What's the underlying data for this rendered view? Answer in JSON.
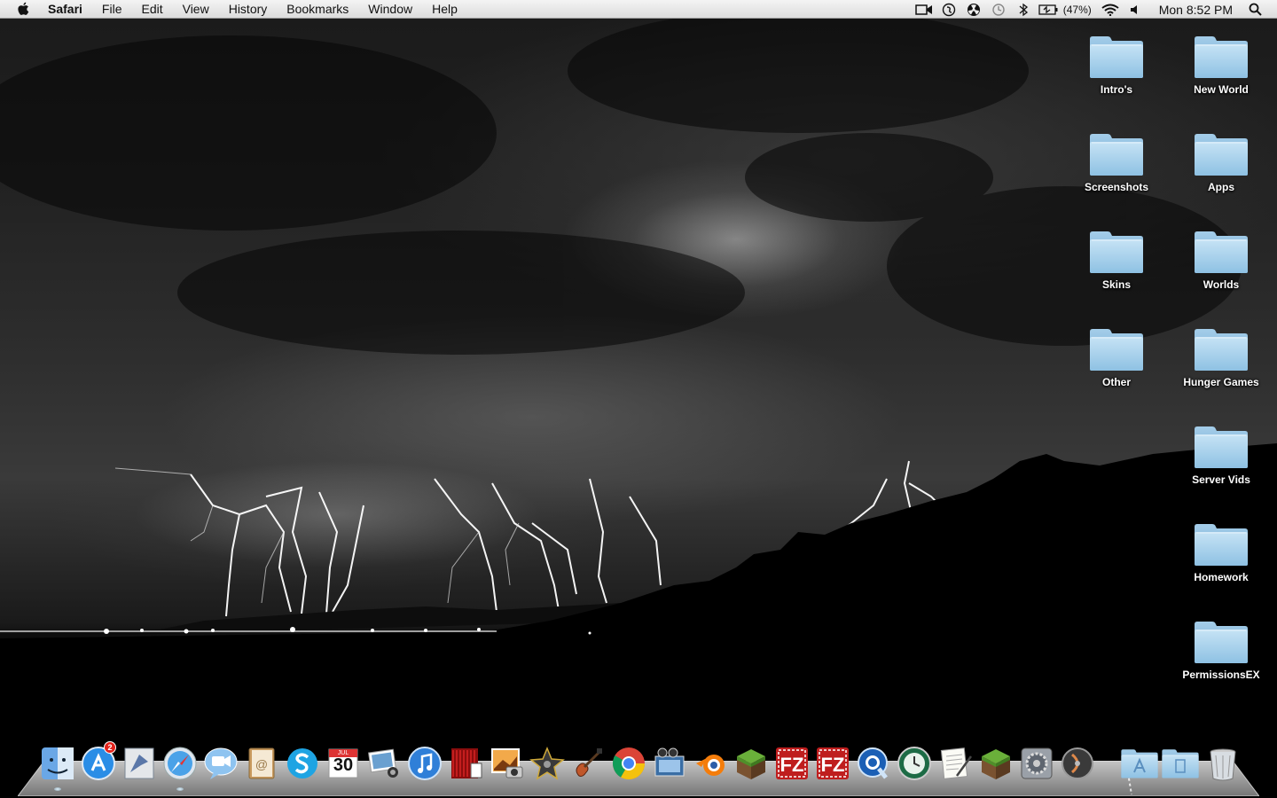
{
  "menubar": {
    "app_name": "Safari",
    "menus": [
      "File",
      "Edit",
      "View",
      "History",
      "Bookmarks",
      "Window",
      "Help"
    ],
    "status": {
      "battery_percent": "(47%)",
      "clock": "Mon 8:52 PM"
    },
    "icons": [
      "camera-icon",
      "script-icon",
      "radiation-icon",
      "time-machine-icon",
      "bluetooth-icon",
      "battery-icon",
      "wifi-icon",
      "volume-icon",
      "spotlight-icon"
    ]
  },
  "desktop": {
    "folders": [
      {
        "label": "Intro's"
      },
      {
        "label": "New World"
      },
      {
        "label": "Screenshots"
      },
      {
        "label": "Apps"
      },
      {
        "label": "Skins"
      },
      {
        "label": "Worlds"
      },
      {
        "label": "Other"
      },
      {
        "label": "Hunger Games"
      },
      {
        "label": "Server Vids"
      },
      {
        "label": "Homework"
      },
      {
        "label": "PermissionsEX"
      }
    ]
  },
  "dock": {
    "app_store_badge": "2",
    "calendar_day": "30",
    "calendar_month": "JUL",
    "apps": [
      "finder",
      "app-store",
      "mail",
      "safari",
      "facetime",
      "address-book",
      "skype",
      "ical",
      "iphoto",
      "itunes",
      "photo-booth",
      "image-capture",
      "imovie",
      "garageband",
      "chrome",
      "video-editor",
      "blender",
      "minecraft",
      "filezilla",
      "filezilla-2",
      "quicktime",
      "time-machine",
      "textedit",
      "minecraft-2",
      "system-preferences",
      "dvd-player",
      "applications-stack",
      "documents-stack",
      "trash"
    ]
  },
  "colors": {
    "menubar": "#e8e8e8",
    "folder": "#a9d2ee",
    "badge": "#e2221b"
  }
}
